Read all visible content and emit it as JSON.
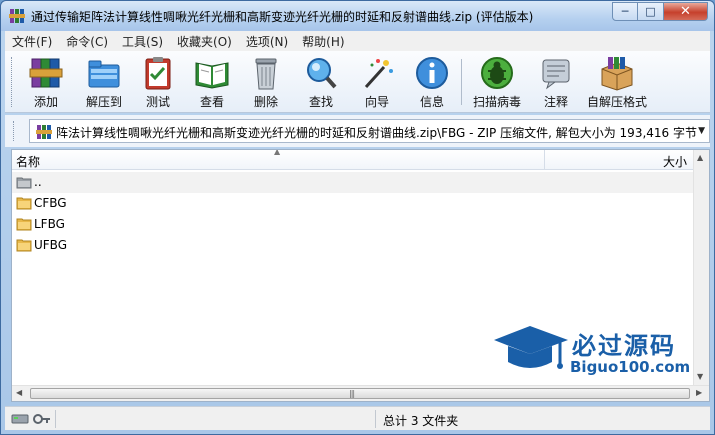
{
  "window": {
    "title": "通过传输矩阵法计算线性啁啾光纤光栅和高斯变迹光纤光栅的时延和反射谱曲线.zip (评估版本)"
  },
  "menu": [
    "文件(F)",
    "命令(C)",
    "工具(S)",
    "收藏夹(O)",
    "选项(N)",
    "帮助(H)"
  ],
  "toolbar": [
    {
      "label": "添加",
      "icon": "books-add-icon"
    },
    {
      "label": "解压到",
      "icon": "folder-extract-icon"
    },
    {
      "label": "测试",
      "icon": "clipboard-check-icon"
    },
    {
      "label": "查看",
      "icon": "book-view-icon"
    },
    {
      "label": "删除",
      "icon": "trash-icon"
    },
    {
      "label": "查找",
      "icon": "magnifier-icon"
    },
    {
      "label": "向导",
      "icon": "wand-icon"
    },
    {
      "label": "信息",
      "icon": "info-icon"
    },
    {
      "label": "扫描病毒",
      "icon": "bug-scan-icon"
    },
    {
      "label": "注释",
      "icon": "comment-icon"
    },
    {
      "label": "自解压格式",
      "icon": "sfx-box-icon"
    }
  ],
  "address": {
    "path": "阵法计算线性啁啾光纤光栅和高斯变迹光纤光栅的时延和反射谱曲线.zip\\FBG - ZIP 压缩文件, 解包大小为 193,416 字节"
  },
  "list": {
    "columns": {
      "name": "名称",
      "size": "大小"
    },
    "rows": [
      {
        "name": "..",
        "icon": "parent-folder-icon"
      },
      {
        "name": "CFBG",
        "icon": "folder-icon"
      },
      {
        "name": "LFBG",
        "icon": "folder-icon"
      },
      {
        "name": "UFBG",
        "icon": "folder-icon"
      }
    ]
  },
  "watermark": {
    "title": "必过源码",
    "site": "Biguo100.com"
  },
  "status": {
    "summary": "总计 3 文件夹"
  },
  "colors": {
    "accent": "#1a5fa8",
    "folder": "#e8b84a",
    "close": "#c6402c"
  }
}
